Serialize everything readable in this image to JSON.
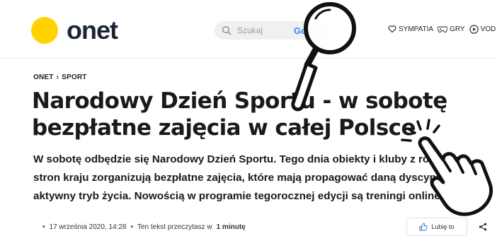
{
  "header": {
    "logo_text": "onet",
    "search_placeholder": "Szukaj",
    "search_engine_mark": "Go",
    "nav": [
      {
        "label": "SYMPATIA"
      },
      {
        "label": "GRY"
      },
      {
        "label": "VOD"
      }
    ]
  },
  "article": {
    "breadcrumb": [
      "ONET",
      "SPORT"
    ],
    "breadcrumb_separator": "›",
    "title": "Narodowy Dzień Sportu - w sobotę bezpłatne zajęcia w całej Polsce",
    "lead": "W sobotę odbędzie się Narodowy Dzień Sportu. Tego dnia obiekty i kluby z różnych stron kraju zorganizują bezpłatne zajęcia, które mają propagować daną dyscyplinę i aktywny tryb życia. Nowością w programie tegorocznej edycji są treningi online.",
    "date": "17 września 2020, 14:28",
    "read_time_prefix": "Ten tekst przeczytasz w",
    "read_time": "1 minutę",
    "like_label": "Lubię to"
  },
  "colors": {
    "brand_yellow": "#ffd200",
    "logo_text": "#1c2533"
  },
  "icons": [
    "search-icon",
    "heart-icon",
    "gamepad-icon",
    "play-icon",
    "profile-card-icon",
    "thumbs-up-icon",
    "share-icon",
    "magnifying-glass-icon",
    "pointing-hand-icon"
  ]
}
